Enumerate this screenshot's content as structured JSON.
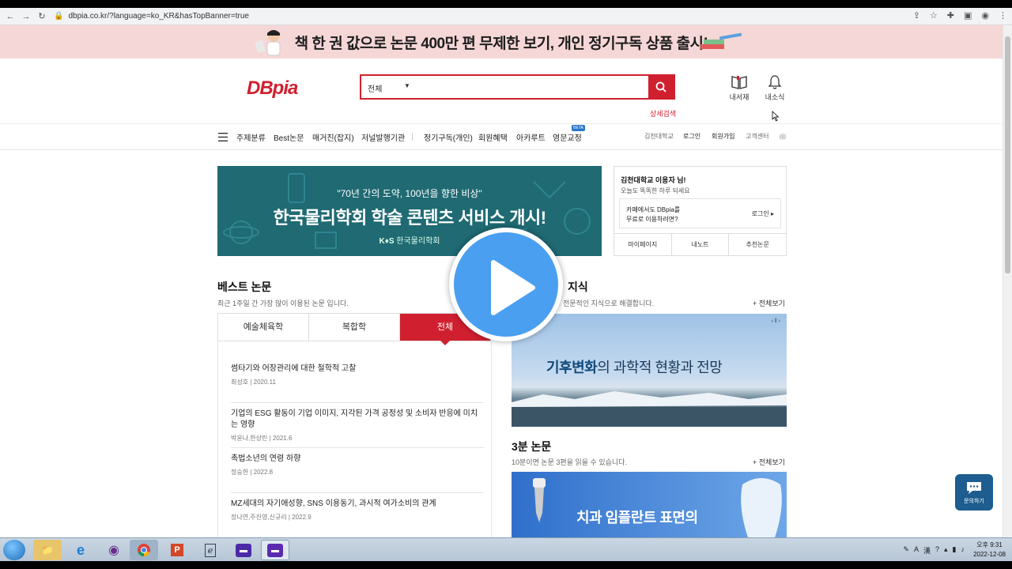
{
  "browser": {
    "url": "dbpia.co.kr/?language=ko_KR&hasTopBanner=true"
  },
  "top_banner": {
    "text": "책 한 권 값으로 논문 400만 편 무제한 보기, 개인 정기구독 상품 출시!"
  },
  "header": {
    "logo": "DBpia",
    "search_category": "전체",
    "advanced_search": "상세검색",
    "my_library": "내서재",
    "my_news": "내소식"
  },
  "nav": {
    "items": [
      "주제분류",
      "Best논문",
      "매거진(잡지)",
      "저널발행기관",
      "정기구독(개인)",
      "회원혜택",
      "아카루트",
      "영문교정"
    ],
    "beta": "BETA",
    "util": [
      "김천대학교",
      "로그인",
      "회원가입",
      "고객센터"
    ]
  },
  "main_banner": {
    "subtitle": "\"70년 간의 도약, 100년을 향한 비상\"",
    "title": "한국물리학회 학술 콘텐츠 서비스 개시!",
    "org": "한국물리학회"
  },
  "user_box": {
    "greeting": "김천대학교 이용자 님!",
    "greeting2": "오늘도 똑똑한 하루 되세요",
    "cafe_line1": "카페에서도 DBpia를",
    "cafe_line2": "무료로 이용하려면?",
    "login": "로그인",
    "tabs": [
      "마이페이지",
      "내노트",
      "추천논문"
    ]
  },
  "best": {
    "title": "베스트 논문",
    "desc": "최근 1주일 간 가장 많이 이용된 논문 입니다.",
    "tabs": [
      "예술체육학",
      "복합학",
      "전체"
    ],
    "papers": [
      {
        "title": "썸타기와 어장관리에 대한 철학적 고찰",
        "author": "최성호",
        "year": "2020.11"
      },
      {
        "title": "기업의 ESG 활동이 기업 이미지, 지각된 가격 공정성 및 소비자 반응에 미치는 영향",
        "author": "박윤나,한상린",
        "year": "2021.6"
      },
      {
        "title": "촉법소년의 연령 하향",
        "author": "정승헌",
        "year": "2022.8"
      },
      {
        "title": "MZ세대의 자기애성향, SNS 이용동기, 과시적 여가소비의 관계",
        "author": "장나연,주진영,신규리",
        "year": "2022.9"
      }
    ]
  },
  "knowledge": {
    "title": "지식",
    "desc": "전문적인 지식으로 해결합니다.",
    "more": "+ 전체보기",
    "banner_highlight": "기후변화",
    "banner_rest": "의 과학적 현황과 전망"
  },
  "three_min": {
    "title": "3분 논문",
    "desc": "10분이면 논문 3편을 읽을 수 있습니다.",
    "more": "+ 전체보기",
    "banner_text": "치과 임플란트 표면의"
  },
  "chat": {
    "label": "문의하기"
  },
  "taskbar": {
    "time": "오후 9:31",
    "date": "2022-12-08"
  }
}
